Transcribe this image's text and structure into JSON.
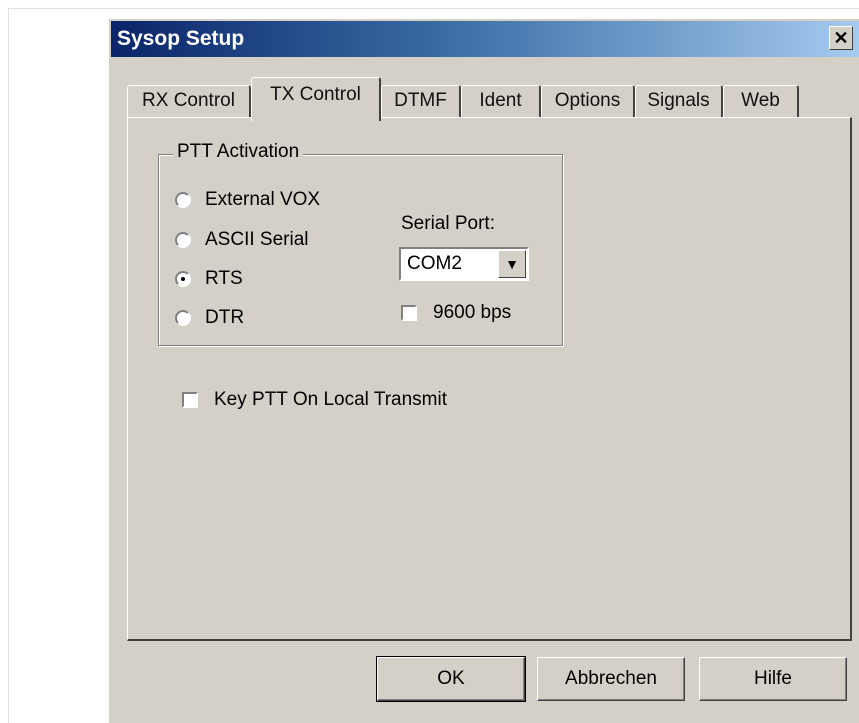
{
  "window": {
    "title": "Sysop Setup",
    "close_glyph": "✕"
  },
  "tabs": [
    {
      "label": "RX Control"
    },
    {
      "label": "TX Control"
    },
    {
      "label": "DTMF"
    },
    {
      "label": "Ident"
    },
    {
      "label": "Options"
    },
    {
      "label": "Signals"
    },
    {
      "label": "Web"
    }
  ],
  "active_tab": "TX Control",
  "ptt": {
    "legend": "PTT Activation",
    "options": [
      {
        "label": "External VOX",
        "checked": false
      },
      {
        "label": "ASCII Serial",
        "checked": false
      },
      {
        "label": "RTS",
        "checked": true
      },
      {
        "label": "DTR",
        "checked": false
      }
    ],
    "serial_port_label": "Serial Port:",
    "serial_port_value": "COM2",
    "baud_label": "9600 bps",
    "baud_checked": false
  },
  "key_ptt": {
    "label": "Key PTT On Local Transmit",
    "checked": false
  },
  "buttons": {
    "ok": "OK",
    "cancel": "Abbrechen",
    "help": "Hilfe"
  }
}
